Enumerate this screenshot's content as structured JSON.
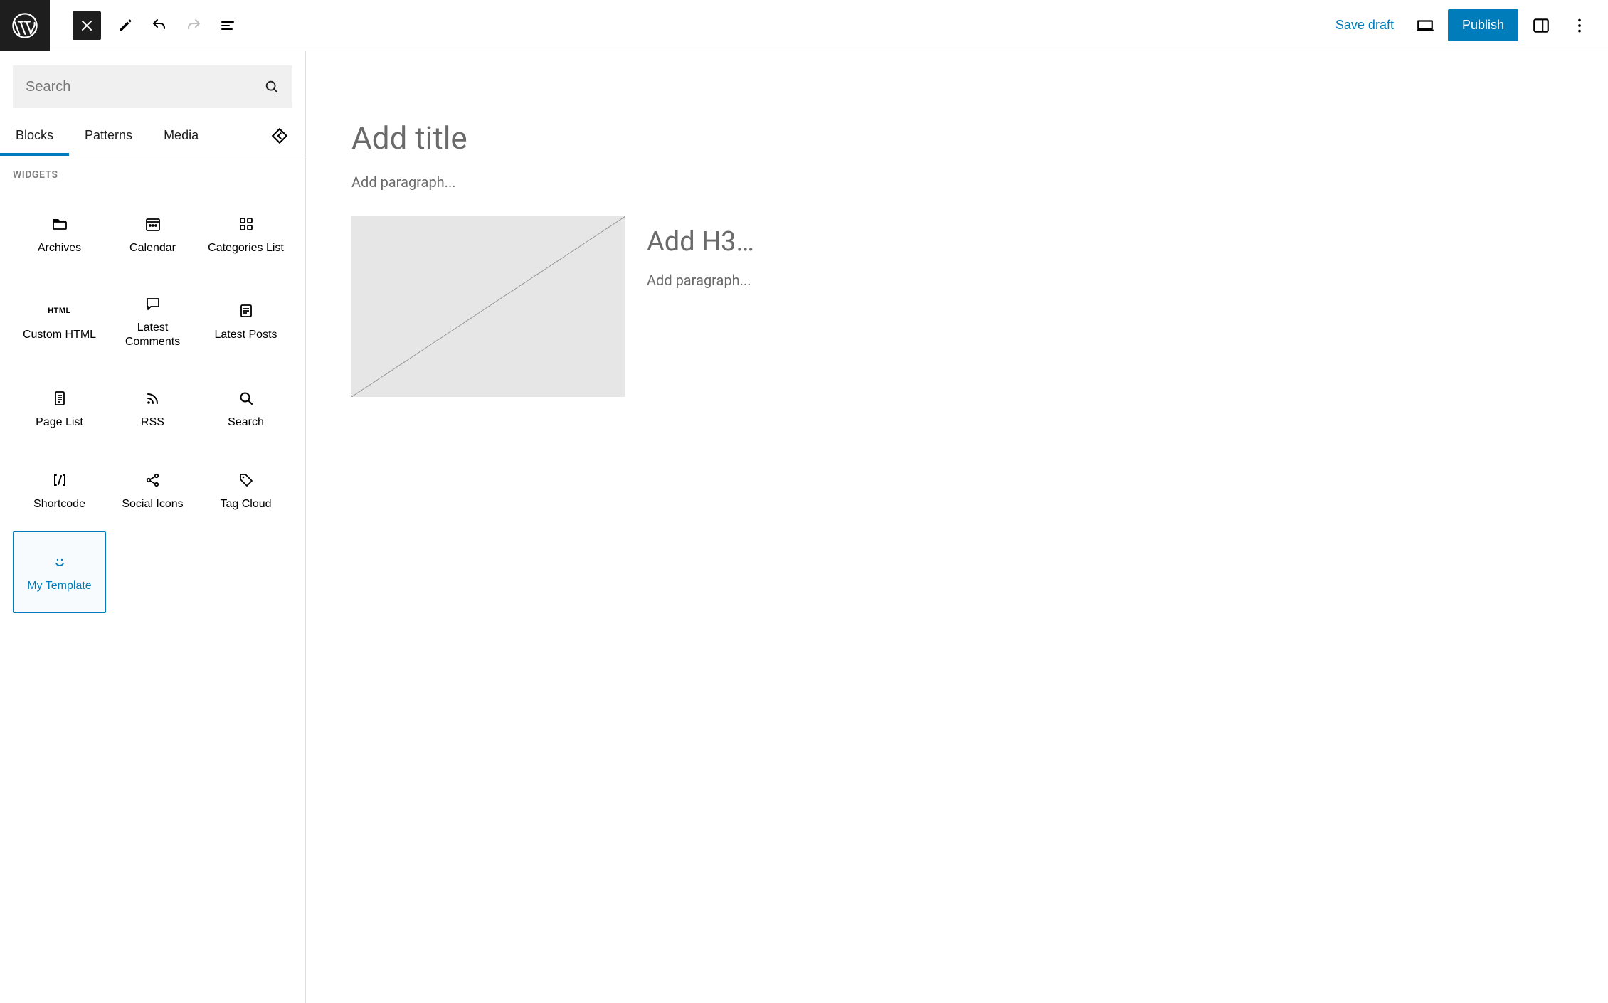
{
  "topbar": {
    "save_draft": "Save draft",
    "publish": "Publish"
  },
  "inserter": {
    "search_placeholder": "Search",
    "tabs": {
      "blocks": "Blocks",
      "patterns": "Patterns",
      "media": "Media"
    },
    "section_label": "WIDGETS",
    "blocks": [
      {
        "id": "archives",
        "label": "Archives"
      },
      {
        "id": "calendar",
        "label": "Calendar"
      },
      {
        "id": "categories-list",
        "label": "Categories List"
      },
      {
        "id": "custom-html",
        "label": "Custom HTML"
      },
      {
        "id": "latest-comments",
        "label": "Latest Comments"
      },
      {
        "id": "latest-posts",
        "label": "Latest Posts"
      },
      {
        "id": "page-list",
        "label": "Page List"
      },
      {
        "id": "rss",
        "label": "RSS"
      },
      {
        "id": "search",
        "label": "Search"
      },
      {
        "id": "shortcode",
        "label": "Shortcode"
      },
      {
        "id": "social-icons",
        "label": "Social Icons"
      },
      {
        "id": "tag-cloud",
        "label": "Tag Cloud"
      },
      {
        "id": "my-template",
        "label": "My Template",
        "selected": true
      }
    ]
  },
  "editor": {
    "title_placeholder": "Add title",
    "paragraph_placeholder": "Add paragraph...",
    "h3_placeholder": "Add H3…",
    "paragraph2_placeholder": "Add paragraph..."
  },
  "colors": {
    "accent": "#007cba",
    "muted": "#6a6a6a"
  }
}
